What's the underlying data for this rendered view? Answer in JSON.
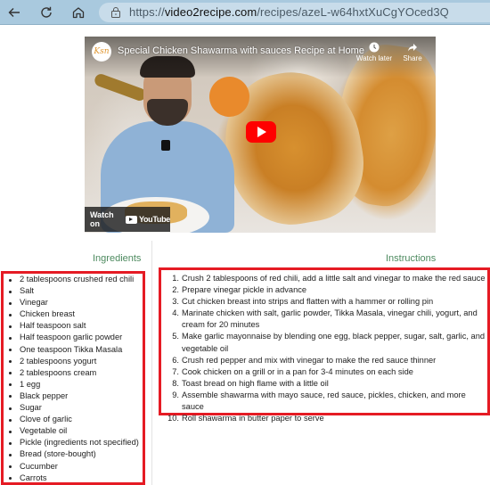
{
  "browser": {
    "url_scheme": "https://",
    "url_host": "video2recipe.com",
    "url_path": "/recipes/azeL-w64hxtXuCgYOced3Q"
  },
  "video": {
    "channel_logo_text": "Ksn",
    "title": "Special Chicken Shawarma with sauces Recipe at Home",
    "watch_later_label": "Watch later",
    "share_label": "Share",
    "watch_on_label": "Watch on",
    "youtube_label": "YouTube"
  },
  "ingredients": {
    "heading": "Ingredients",
    "items": [
      "2 tablespoons crushed red chili",
      "Salt",
      "Vinegar",
      "Chicken breast",
      "Half teaspoon salt",
      "Half teaspoon garlic powder",
      "One teaspoon Tikka Masala",
      "2 tablespoons yogurt",
      "2 tablespoons cream",
      "1 egg",
      "Black pepper",
      "Sugar",
      "Clove of garlic",
      "Vegetable oil",
      "Pickle (ingredients not specified)",
      "Bread (store-bought)",
      "Cucumber",
      "Carrots"
    ]
  },
  "instructions": {
    "heading": "Instructions",
    "steps": [
      {
        "num": "1.",
        "text": "Crush 2 tablespoons of red chili, add a little salt and vinegar to make the red sauce"
      },
      {
        "num": "2.",
        "text": "Prepare vinegar pickle in advance"
      },
      {
        "num": "3.",
        "text": "Cut chicken breast into strips and flatten with a hammer or rolling pin"
      },
      {
        "num": "4.",
        "text": "Marinate chicken with salt, garlic powder, Tikka Masala, vinegar chili, yogurt, and cream for 20 minutes"
      },
      {
        "num": "5.",
        "text": "Make garlic mayonnaise by blending one egg, black pepper, sugar, salt, garlic, and vegetable oil"
      },
      {
        "num": "6.",
        "text": "Crush red pepper and mix with vinegar to make the red sauce thinner"
      },
      {
        "num": "7.",
        "text": "Cook chicken on a grill or in a pan for 3-4 minutes on each side"
      },
      {
        "num": "8.",
        "text": "Toast bread on high flame with a little oil"
      },
      {
        "num": "9.",
        "text": "Assemble shawarma with mayo sauce, red sauce, pickles, chicken, and more sauce"
      },
      {
        "num": "10.",
        "text": "Roll shawarma in butter paper to serve"
      }
    ]
  },
  "colors": {
    "heading_green": "#4d8a5f",
    "highlight_red": "#e51b24",
    "youtube_red": "#ff0000",
    "toolbar_blue": "#a9c9de"
  }
}
